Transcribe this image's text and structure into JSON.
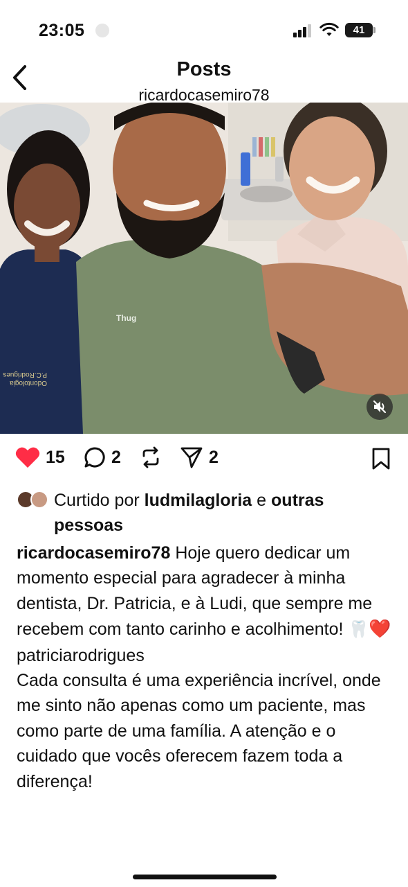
{
  "status_bar": {
    "time": "23:05",
    "battery": "41",
    "icons": [
      "cellular-signal-icon",
      "wifi-icon",
      "battery-icon"
    ]
  },
  "header": {
    "title": "Posts",
    "username": "ricardocasemiro78",
    "back_icon": "chevron-left-icon"
  },
  "post": {
    "image_alt_overlay_icon": "speaker-muted-icon",
    "actions": {
      "like_count": "15",
      "comment_count": "2",
      "share_count": "2",
      "liked": true,
      "like_color": "#ff2d46"
    },
    "likes": {
      "prefix": "Curtido por",
      "user": "ludmilagloria",
      "connector": "e",
      "others": "outras pessoas"
    },
    "caption": {
      "username": "ricardocasemiro78",
      "text_1": "Hoje quero dedicar um momento especial para agradecer à minha dentista, Dr. Patricia, e à Ludi, que sempre me recebem com tanto carinho e acolhimento!",
      "emoji_tooth": "🦷",
      "emoji_heart": "❤️",
      "mention": "patriciarodrigues",
      "text_2": "Cada consulta é uma experiência incrível, onde me sinto não apenas como um paciente, mas como parte de uma família. A atenção e o cuidado que vocês oferecem fazem toda a diferença!"
    }
  }
}
